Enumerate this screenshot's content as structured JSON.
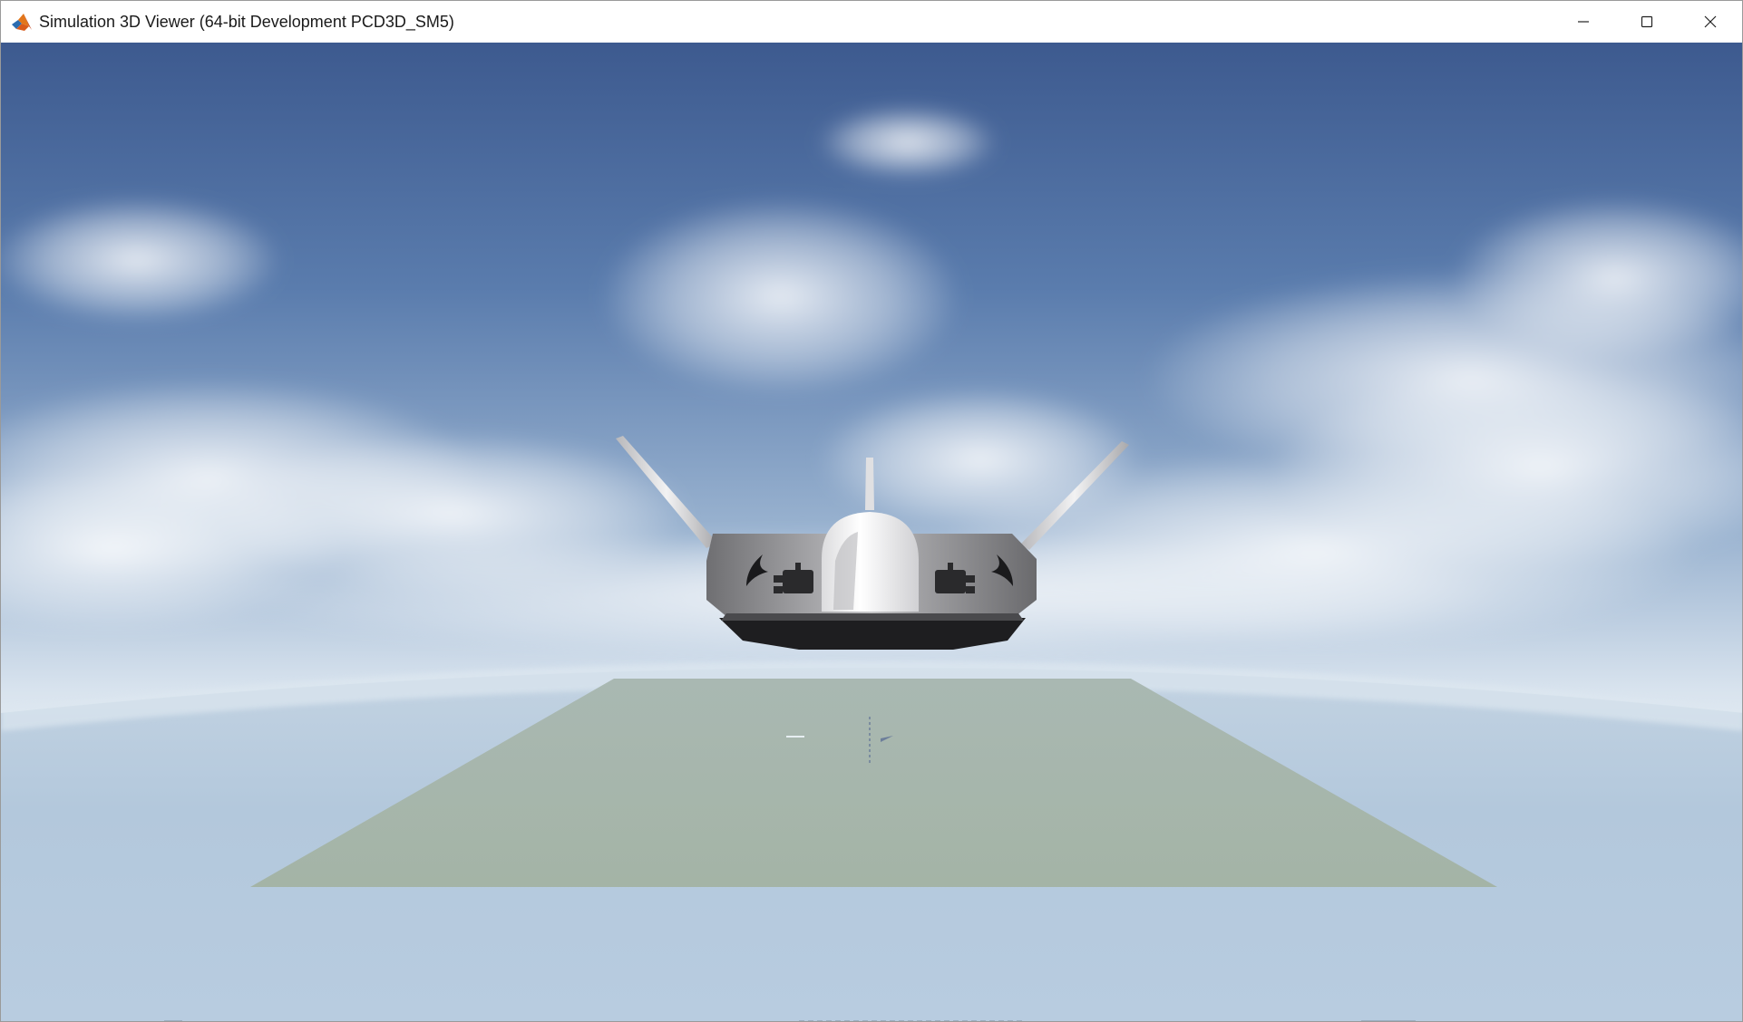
{
  "window": {
    "title": "Simulation 3D Viewer (64-bit Development PCD3D_SM5)",
    "app_icon": "matlab-logo-icon",
    "controls": [
      "minimize-icon",
      "maximize-icon",
      "close-icon"
    ]
  },
  "scene": {
    "sky_top_color": "#3d5f94",
    "sky_horizon_color": "#dbe6f0",
    "ground_color": "#b3c9dd",
    "pad_color": "#a8b8ae",
    "vehicle_color": "#8e8e90"
  }
}
